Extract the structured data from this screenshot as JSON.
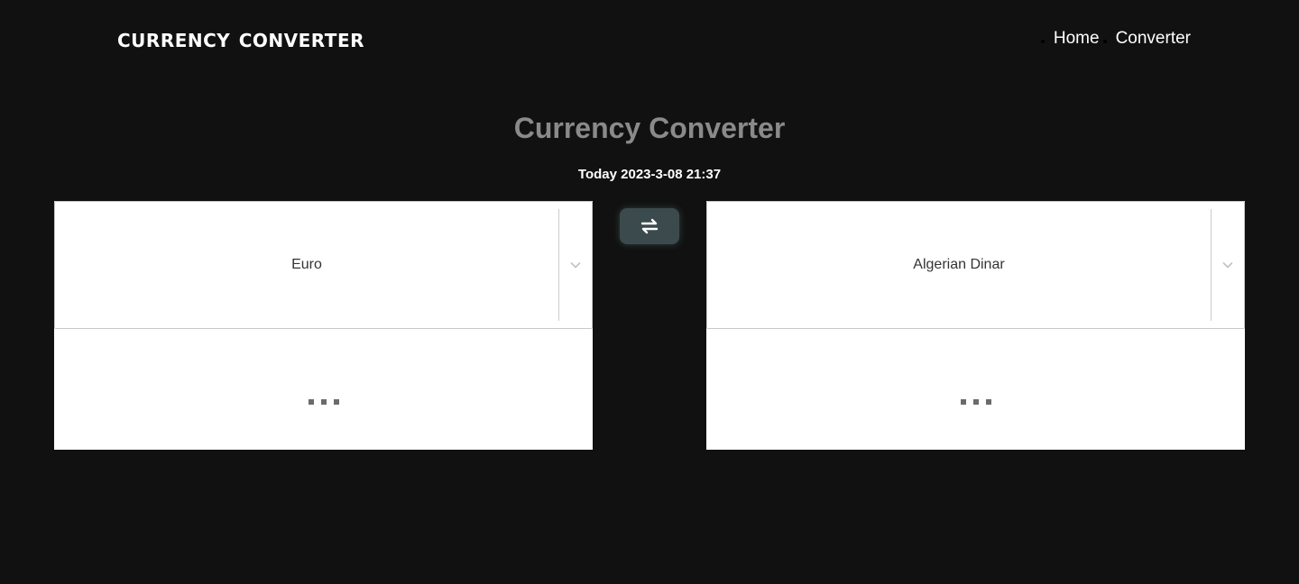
{
  "header": {
    "brand": "CURRENCY CONVERTER",
    "nav": [
      {
        "label": "Home"
      },
      {
        "label": "Converter"
      }
    ]
  },
  "main": {
    "title": "Currency Converter",
    "date": "Today 2023-3-08 21:37",
    "from": {
      "currency": "Euro",
      "result": "..."
    },
    "to": {
      "currency": "Algerian Dinar",
      "result": "..."
    },
    "swap_icon": "swap-arrows-icon"
  },
  "colors": {
    "background": "#111111",
    "title": "#8a8a8a",
    "swap_button": "#3b4a4c",
    "panel": "#ffffff"
  }
}
